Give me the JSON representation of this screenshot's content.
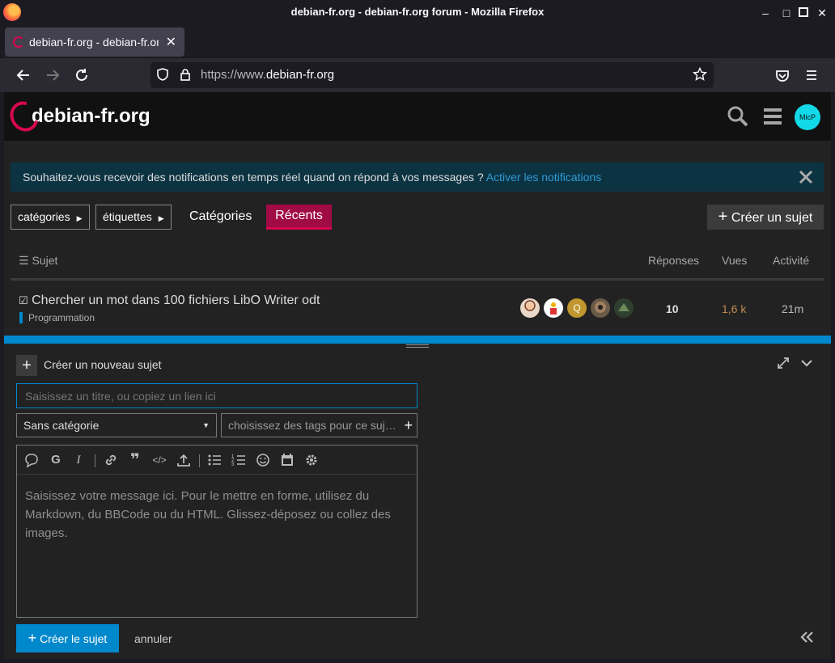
{
  "window": {
    "title": "debian-fr.org - debian-fr.org forum - Mozilla Firefox",
    "min": "–",
    "max": "□",
    "close": "✕"
  },
  "browser": {
    "tab_title": "debian-fr.org - debian-fr.org",
    "tab_close": "✕",
    "new_tab": "+",
    "url_prefix": "https://www.",
    "url_domain": "debian-fr.org"
  },
  "header": {
    "logo_text": "debian-fr.org",
    "avatar_text": "MicP"
  },
  "notification": {
    "message": "Souhaitez-vous recevoir des notifications en temps réel quand on répond à vos messages ?",
    "link": "Activer les notifications"
  },
  "nav": {
    "categories_dropdown": "catégories",
    "tags_dropdown": "étiquettes",
    "categories_link": "Catégories",
    "recent_tab": "Récents",
    "create_topic": "Créer un sujet"
  },
  "table": {
    "headers": {
      "topic": "Sujet",
      "replies": "Réponses",
      "views": "Vues",
      "activity": "Activité"
    },
    "row": {
      "title": "Chercher un mot dans 100 fichiers LibO Writer odt",
      "category": "Programmation",
      "replies": "10",
      "views": "1,6 k",
      "activity": "21m",
      "poster_letter": "Q"
    }
  },
  "composer": {
    "header": "Créer un nouveau sujet",
    "title_placeholder": "Saisissez un titre, ou copiez un lien ici",
    "category": "Sans catégorie",
    "tags_placeholder": "choisissez des tags pour ce suj…",
    "body_placeholder": "Saisissez votre message ici. Pour le mettre en forme, utilisez du Markdown, du BBCode ou du HTML. Glissez-déposez ou collez des images.",
    "submit": "Créer le sujet",
    "cancel": "annuler"
  },
  "colors": {
    "brand": "#d70751",
    "accent": "#0088cc",
    "recent_tab": "#a00a45",
    "avatar": "#12d9e8",
    "views": "#c08b52"
  }
}
